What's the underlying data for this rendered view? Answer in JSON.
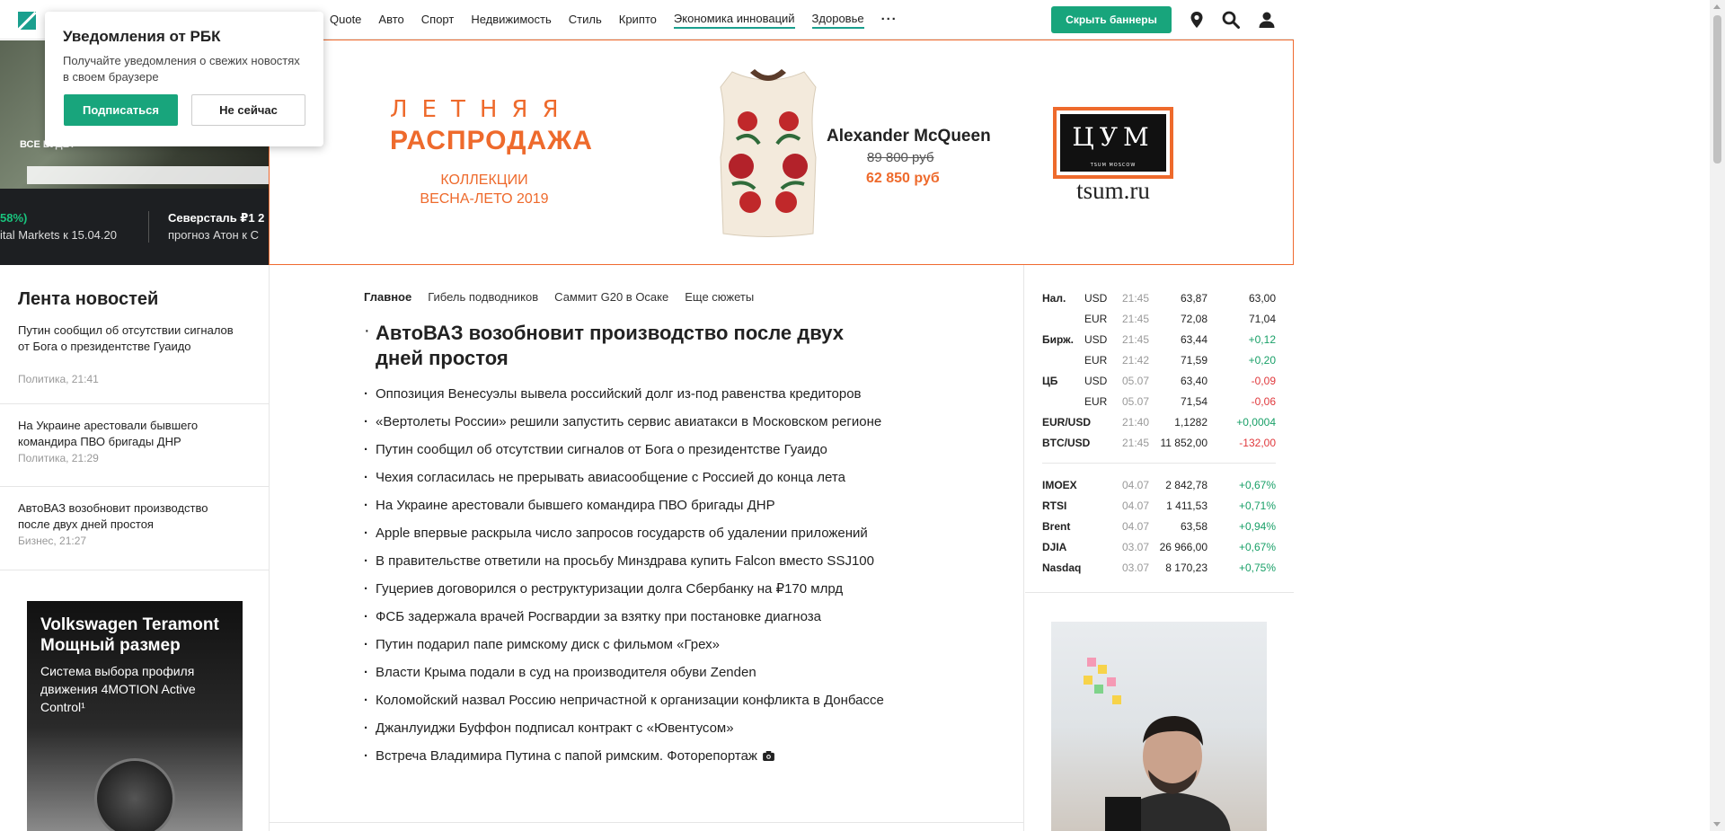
{
  "header": {
    "nav": [
      {
        "label": "Quote",
        "ul": false
      },
      {
        "label": "Авто",
        "ul": false
      },
      {
        "label": "Спорт",
        "ul": false
      },
      {
        "label": "Недвижимость",
        "ul": false
      },
      {
        "label": "Стиль",
        "ul": false
      },
      {
        "label": "Крипто",
        "ul": false
      },
      {
        "label": "Экономика инноваций",
        "ul": true
      },
      {
        "label": "Здоровье",
        "ul": true
      }
    ],
    "more_label": "···",
    "hide_banners_label": "Скрыть баннеры",
    "icons": [
      "location-pin-icon",
      "search-icon",
      "user-icon"
    ]
  },
  "notification": {
    "title": "Уведомления от РБК",
    "text": "Получайте уведомления о свежих новостях в своем браузере",
    "subscribe_label": "Подписаться",
    "dismiss_label": "Не сейчас"
  },
  "top_strip": {
    "video_caption": "ВСЕ БУДЕТ",
    "ticker1_value": "58%)",
    "ticker1_sub": "ital Markets к 15.04.20",
    "ticker2_value": "Северсталь ₽1 2",
    "ticker2_sub": "прогноз Атон к С"
  },
  "banner": {
    "line1": "ЛЕТНЯЯ",
    "line2": "РАСПРОДАЖА",
    "line3": "КОЛЛЕКЦИИ",
    "line4": "ВЕСНА-ЛЕТО 2019",
    "brand": "Alexander McQueen",
    "old_price": "89 800 руб",
    "new_price": "62 850 руб",
    "store_logo": "ЦУМ",
    "store_logo_sub": "TSUM MOSCOW",
    "store_url": "tsum.ru",
    "accent": "#ee6a2c"
  },
  "feed": {
    "title": "Лента новостей",
    "items": [
      {
        "text": "Путин сообщил об отсутствии сигналов от Бога о президентстве Гуаидо",
        "meta": "Политика, 21:41"
      },
      {
        "text": "На Украине арестовали бывшего командира ПВО бригады ДНР",
        "meta": "Политика, 21:29"
      },
      {
        "text": "АвтоВАЗ возобновит производство после двух дней простоя",
        "meta": "Бизнес, 21:27"
      }
    ]
  },
  "left_ad": {
    "headline1": "Volkswagen Teramont",
    "headline2": "Мощный размер",
    "sub": "Система выбора профиля движения 4MOTION Active Control¹"
  },
  "center": {
    "tabs": [
      {
        "label": "Главное",
        "active": true
      },
      {
        "label": "Гибель подводников",
        "active": false
      },
      {
        "label": "Саммит G20 в Осаке",
        "active": false
      },
      {
        "label": "Еще сюжеты",
        "active": false
      }
    ],
    "main_headline": "АвтоВАЗ возобновит производство после двух дней простоя",
    "news": [
      "Оппозиция Венесуэлы вывела российский долг из-под равенства кредиторов",
      "«Вертолеты России» решили запустить сервис авиатакси в Московском регионе",
      "Путин сообщил об отсутствии сигналов от Бога о президентстве Гуаидо",
      "Чехия согласилась не прерывать авиасообщение с Россией до конца лета",
      "На Украине арестовали бывшего командира ПВО бригады ДНР",
      "Apple впервые раскрыла число запросов государств об удалении приложений",
      "В правительстве ответили на просьбу Минздрава купить Falcon вместо SSJ100",
      "Гуцериев договорился о реструктуризации долга Сбербанку на ₽170 млрд",
      "ФСБ задержала врачей Росгвардии за взятку при постановке диагноза",
      "Путин подарил папе римскому диск с фильмом «Грех»",
      "Власти Крыма подали в суд на производителя обуви Zenden",
      "Коломойский назвал Россию непричастной к организации конфликта в Донбассе",
      "Джанлуиджи Буффон подписал контракт с «Ювентусом»",
      "Встреча Владимира Путина с папой римским. Фоторепортаж"
    ]
  },
  "quotes": {
    "currency": [
      {
        "label": "Нал.",
        "cur": "USD",
        "time": "21:45",
        "value": "63,87",
        "change": "63,00",
        "tone": "n"
      },
      {
        "label": "",
        "cur": "EUR",
        "time": "21:45",
        "value": "72,08",
        "change": "71,04",
        "tone": "n"
      },
      {
        "label": "Бирж.",
        "cur": "USD",
        "time": "21:45",
        "value": "63,44",
        "change": "+0,12",
        "tone": "g"
      },
      {
        "label": "",
        "cur": "EUR",
        "time": "21:42",
        "value": "71,59",
        "change": "+0,20",
        "tone": "g"
      },
      {
        "label": "ЦБ",
        "cur": "USD",
        "time": "05.07",
        "value": "63,40",
        "change": "-0,09",
        "tone": "r"
      },
      {
        "label": "",
        "cur": "EUR",
        "time": "05.07",
        "value": "71,54",
        "change": "-0,06",
        "tone": "r"
      },
      {
        "label": "EUR/USD",
        "cur": "",
        "time": "21:40",
        "value": "1,1282",
        "change": "+0,0004",
        "tone": "g"
      },
      {
        "label": "BTC/USD",
        "cur": "",
        "time": "21:45",
        "value": "11 852,00",
        "change": "-132,00",
        "tone": "r"
      }
    ],
    "indices": [
      {
        "label": "IMOEX",
        "time": "04.07",
        "value": "2 842,78",
        "change": "+0,67%",
        "tone": "g"
      },
      {
        "label": "RTSI",
        "time": "04.07",
        "value": "1 411,53",
        "change": "+0,71%",
        "tone": "g"
      },
      {
        "label": "Brent",
        "time": "04.07",
        "value": "63,58",
        "change": "+0,94%",
        "tone": "g"
      },
      {
        "label": "DJIA",
        "time": "03.07",
        "value": "26 966,00",
        "change": "+0,67%",
        "tone": "g"
      },
      {
        "label": "Nasdaq",
        "time": "03.07",
        "value": "8 170,23",
        "change": "+0,75%",
        "tone": "g"
      }
    ]
  },
  "colors": {
    "brand_green": "#18a57c",
    "positive": "#19a068",
    "negative": "#e0383c",
    "banner_orange": "#ee6a2c"
  }
}
